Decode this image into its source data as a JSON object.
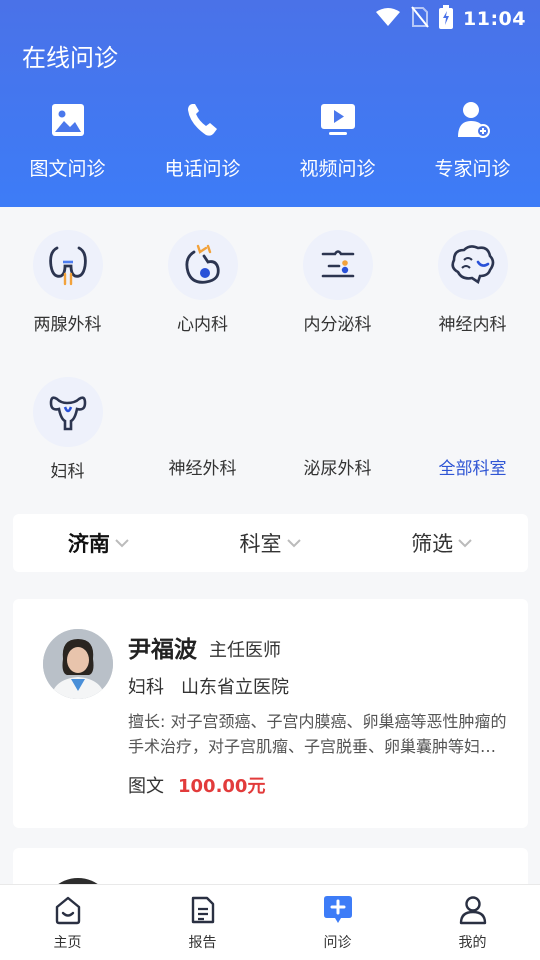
{
  "status_bar": {
    "time": "11:04"
  },
  "header": {
    "title": "在线问诊",
    "consult_types": [
      {
        "label": "图文问诊",
        "icon": "image-icon"
      },
      {
        "label": "电话问诊",
        "icon": "phone-icon"
      },
      {
        "label": "视频问诊",
        "icon": "video-icon"
      },
      {
        "label": "专家问诊",
        "icon": "expert-icon"
      }
    ]
  },
  "departments": [
    {
      "label": "两腺外科",
      "icon": "thyroid-icon"
    },
    {
      "label": "心内科",
      "icon": "heart-icon"
    },
    {
      "label": "内分泌科",
      "icon": "endocrine-icon"
    },
    {
      "label": "神经内科",
      "icon": "brain-icon"
    },
    {
      "label": "妇科",
      "icon": "uterus-icon"
    },
    {
      "label": "神经外科"
    },
    {
      "label": "泌尿外科"
    },
    {
      "label": "全部科室"
    }
  ],
  "filters": [
    {
      "label": "济南"
    },
    {
      "label": "科室"
    },
    {
      "label": "筛选"
    }
  ],
  "doctor": {
    "name": "尹福波",
    "title": "主任医师",
    "department": "妇科",
    "hospital": "山东省立医院",
    "specialty": "擅长: 对子宫颈癌、子宫内膜癌、卵巢癌等恶性肿瘤的手术治疗，对子宫肌瘤、子宫脱垂、卵巢囊肿等妇科良性疾病的诊治",
    "consult_type": "图文",
    "price": "100.00元"
  },
  "tabs": [
    {
      "label": "主页",
      "icon": "home-icon"
    },
    {
      "label": "报告",
      "icon": "report-icon"
    },
    {
      "label": "问诊",
      "icon": "consult-icon"
    },
    {
      "label": "我的",
      "icon": "profile-icon"
    }
  ],
  "colors": {
    "header_gradient_top": "#4a72e8",
    "header_gradient_bottom": "#3d7cf7",
    "accent": "#2f55d4",
    "price": "#e23b3b",
    "dept_circle": "#eef1fb"
  }
}
